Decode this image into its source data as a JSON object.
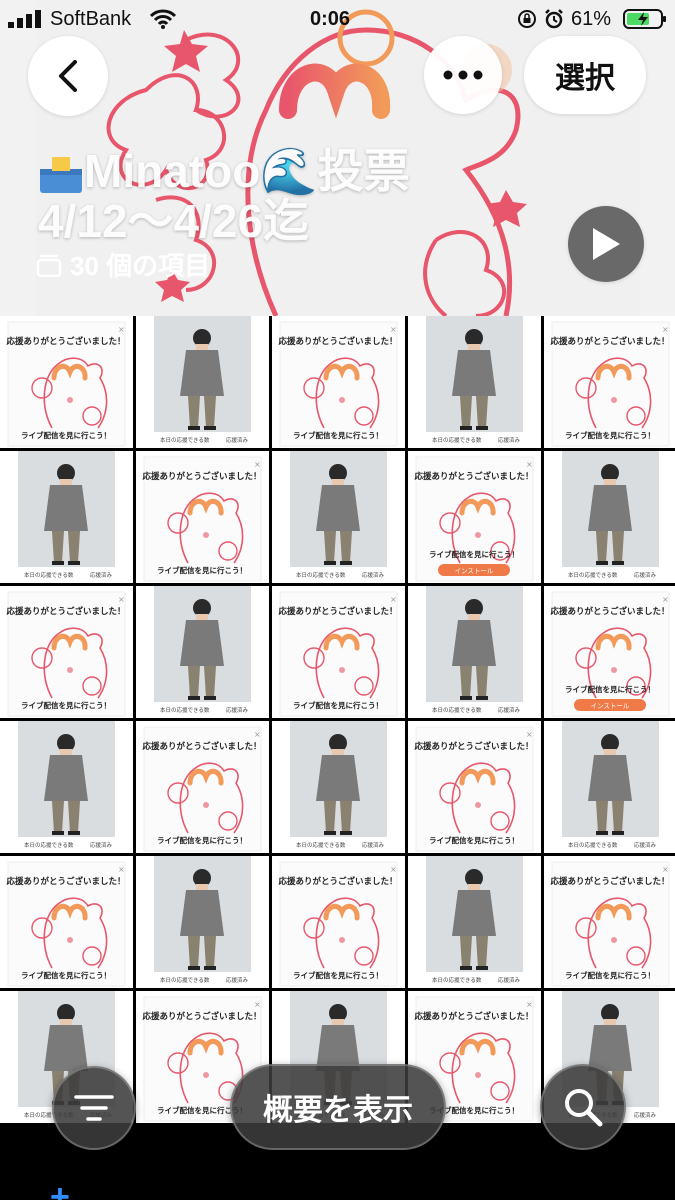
{
  "status_bar": {
    "carrier": "SoftBank",
    "time": "0:06",
    "battery_percent": "61%"
  },
  "header": {
    "select_label": "選択",
    "album_title_line1": "Minatoo🌊投票",
    "album_title_line2": "4/12〜4/26迄",
    "item_count": "30 個の項目",
    "icons": {
      "back": "chevron-left-icon",
      "more": "ellipsis-icon",
      "play": "play-icon",
      "stack": "photo-stack-icon",
      "ballot": "ballot-box-icon"
    }
  },
  "grid": {
    "rows": [
      [
        "card",
        "portrait",
        "card",
        "portrait",
        "card"
      ],
      [
        "portrait",
        "card",
        "portrait",
        "card",
        "portrait"
      ],
      [
        "card",
        "portrait",
        "card",
        "portrait",
        "card"
      ],
      [
        "portrait",
        "card",
        "portrait",
        "card",
        "portrait"
      ],
      [
        "card",
        "portrait",
        "card",
        "portrait",
        "card"
      ],
      [
        "portrait",
        "card",
        "portrait",
        "card",
        "portrait"
      ]
    ],
    "card_heading": "応援ありがとうございました！",
    "card_subtext": "ライブ配信を見に行こう！",
    "install_label": "インストール",
    "portrait_caption": "本日の応援できる数",
    "portrait_status": "応援済み"
  },
  "bottom_bar": {
    "summary_label": "概要を表示",
    "icons": {
      "filter": "filter-lines-icon",
      "search": "search-icon",
      "add": "plus-icon"
    }
  },
  "colors": {
    "accent_pink": "#e8566b",
    "accent_orange": "#f29a5a",
    "install_orange": "#f07a47",
    "backdrop_gray": "#d9dde0",
    "ios_blue": "#2f8cff"
  }
}
